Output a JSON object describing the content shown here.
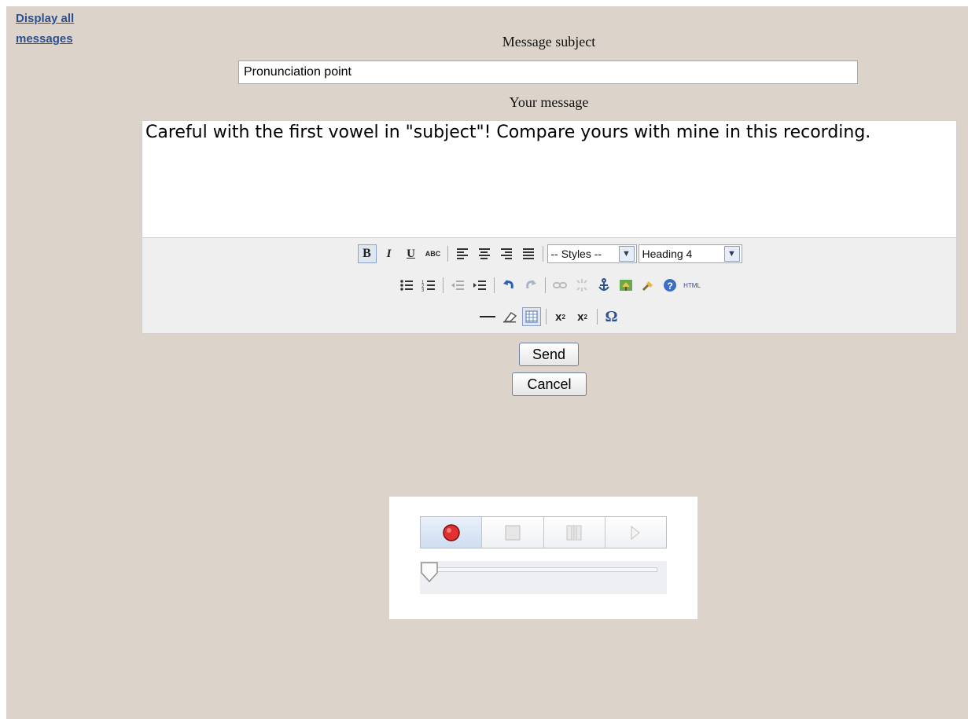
{
  "nav": {
    "display_all_messages": "Display all messages"
  },
  "form": {
    "subject_label": "Message subject",
    "subject_value": "Pronunciation point",
    "message_label": "Your message",
    "message_text": "Careful with the first vowel in \"subject\"! Compare yours with mine in this recording."
  },
  "toolbar": {
    "styles_select": "-- Styles --",
    "format_select": "Heading 4",
    "html_label": "HTML",
    "row1": [
      "bold-icon",
      "italic-icon",
      "underline-icon",
      "strikethrough-icon",
      "align-left-icon",
      "align-center-icon",
      "align-right-icon",
      "align-justify-icon"
    ],
    "row2": [
      "bullet-list-icon",
      "numbered-list-icon",
      "outdent-icon",
      "indent-icon",
      "undo-icon",
      "redo-icon",
      "link-icon",
      "unlink-icon",
      "anchor-icon",
      "image-icon",
      "cleanup-icon",
      "help-icon",
      "html-icon"
    ],
    "row3": [
      "horizontal-rule-icon",
      "remove-format-icon",
      "visual-aid-icon",
      "subscript-icon",
      "superscript-icon",
      "special-char-icon"
    ]
  },
  "buttons": {
    "send": "Send",
    "cancel": "Cancel"
  },
  "recorder": {
    "controls": [
      "record-icon",
      "stop-icon",
      "pause-icon",
      "play-icon"
    ],
    "position_fraction": 0
  },
  "colors": {
    "background": "#dcd4ca",
    "link": "#2b4f8f",
    "record": "#e03030"
  }
}
